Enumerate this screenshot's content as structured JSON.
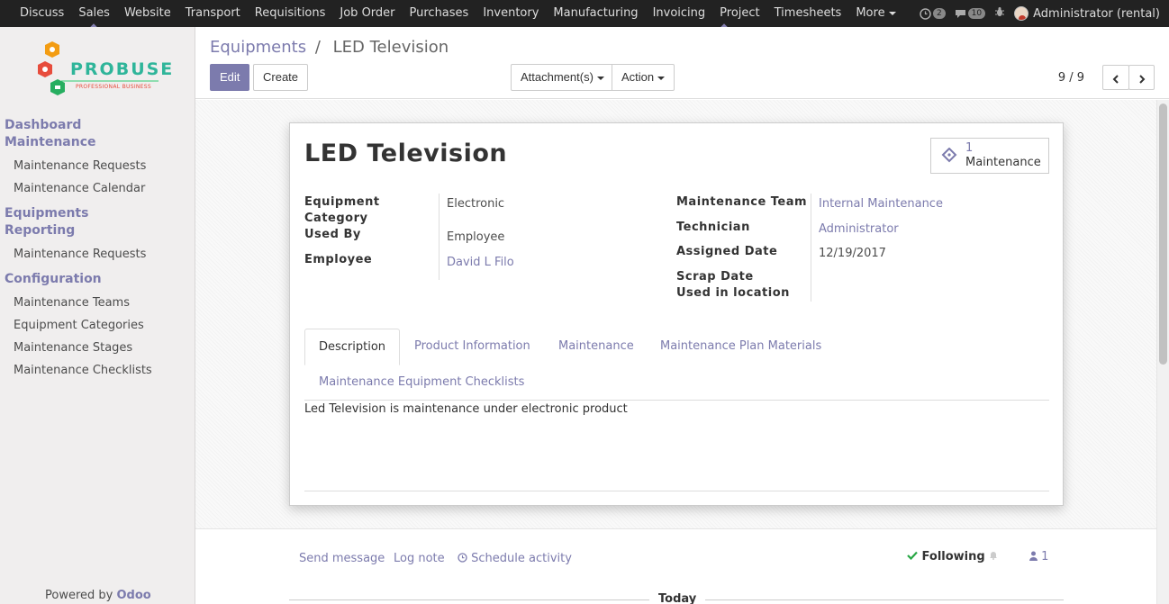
{
  "topbar": {
    "menu": [
      "Discuss",
      "Sales",
      "Website",
      "Transport",
      "Requisitions",
      "Job Order",
      "Purchases",
      "Inventory",
      "Manufacturing",
      "Invoicing",
      "Project",
      "Timesheets",
      "More"
    ],
    "activity_count": "2",
    "message_count": "10",
    "user": "Administrator (rental)"
  },
  "sidebar": {
    "logo_text": "PROBUSE",
    "logo_sub": "PROFESSIONAL BUSINESS",
    "sections": [
      {
        "title": "Dashboard Maintenance",
        "items": [
          "Maintenance Requests",
          "Maintenance Calendar"
        ]
      },
      {
        "title": "Equipments Reporting",
        "items": [
          "Maintenance Requests"
        ]
      },
      {
        "title": "Configuration",
        "items": [
          "Maintenance Teams",
          "Equipment Categories",
          "Maintenance Stages",
          "Maintenance Checklists"
        ]
      }
    ],
    "powered_prefix": "Powered by",
    "powered_brand": "Odoo"
  },
  "control": {
    "breadcrumb_parent": "Equipments",
    "breadcrumb_sep": "/",
    "breadcrumb_current": "LED Television",
    "edit_label": "Edit",
    "create_label": "Create",
    "attachments_label": "Attachment(s)",
    "action_label": "Action",
    "pager": "9 / 9"
  },
  "record": {
    "title": "LED Television",
    "smart_button_value": "1",
    "smart_button_label": "Maintenance",
    "left_fields": {
      "category_label_1": "Equipment",
      "category_label_2": "Category",
      "category_value": "Electronic",
      "used_by_label": "Used By",
      "used_by_value": "Employee",
      "employee_label": "Employee",
      "employee_value": "David L Filo"
    },
    "right_fields": {
      "team_label": "Maintenance Team",
      "team_value": "Internal Maintenance",
      "technician_label": "Technician",
      "technician_value": "Administrator",
      "assigned_label": "Assigned Date",
      "assigned_value": "12/19/2017",
      "scrap_label": "Scrap Date",
      "location_label": "Used in location"
    },
    "tabs": [
      "Description",
      "Product Information",
      "Maintenance",
      "Maintenance Plan Materials",
      "Maintenance Equipment Checklists"
    ],
    "description": "Led Television is maintenance under electronic product"
  },
  "chatter": {
    "send_message": "Send message",
    "log_note": "Log note",
    "schedule_activity": "Schedule activity",
    "following": "Following",
    "followers_count": "1",
    "today": "Today"
  },
  "colors": {
    "accent": "#7c7bad",
    "topbar": "#222222",
    "sidebar": "#f0eeee"
  }
}
